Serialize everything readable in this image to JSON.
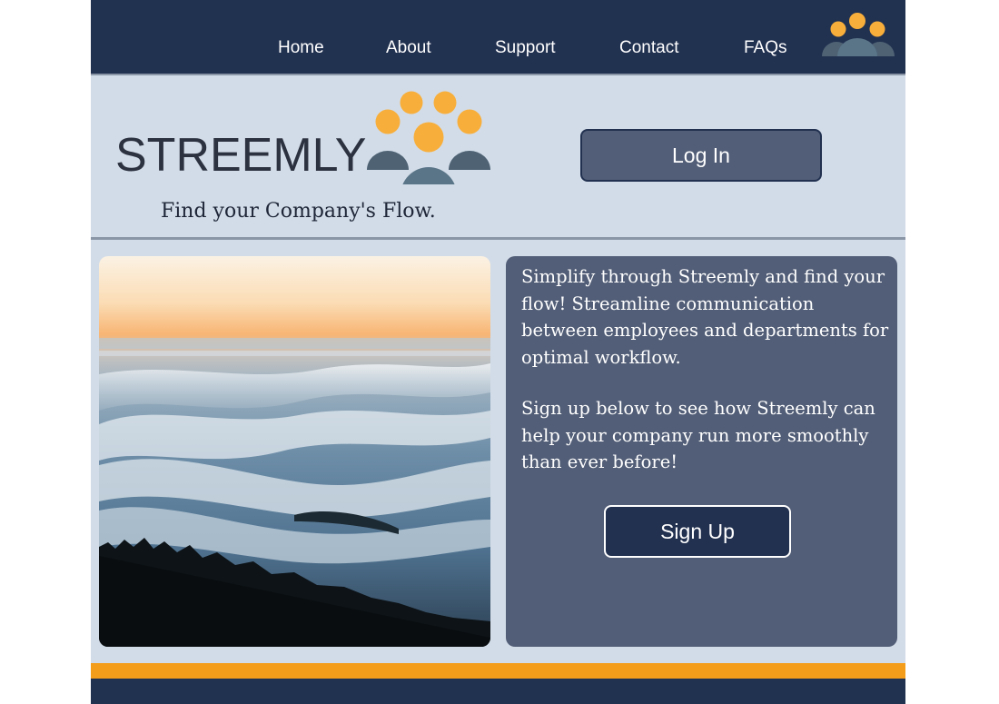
{
  "nav": {
    "links": [
      "Home",
      "About",
      "Support",
      "Contact",
      "FAQs"
    ],
    "logo_icon": "people-group-icon"
  },
  "header": {
    "brand_name": "STREEMLY",
    "tagline": "Find your Company's Flow.",
    "login_label": "Log In",
    "logo_icon": "people-group-icon"
  },
  "hero": {
    "image": "fog-over-forest-photo"
  },
  "info": {
    "paragraph_1": "Simplify through Streemly and find your flow! Streamline communication between employees and departments for optimal workflow.",
    "paragraph_2": "Sign up below to see how Streemly can help your company run more smoothly than ever before!",
    "signup_label": "Sign Up"
  },
  "colors": {
    "navy": "#213150",
    "slate": "#525e77",
    "background": "#d2dce8",
    "accent_orange": "#f49d1a",
    "logo_orange": "#f8ae3a",
    "logo_gray": "#4e6274"
  }
}
